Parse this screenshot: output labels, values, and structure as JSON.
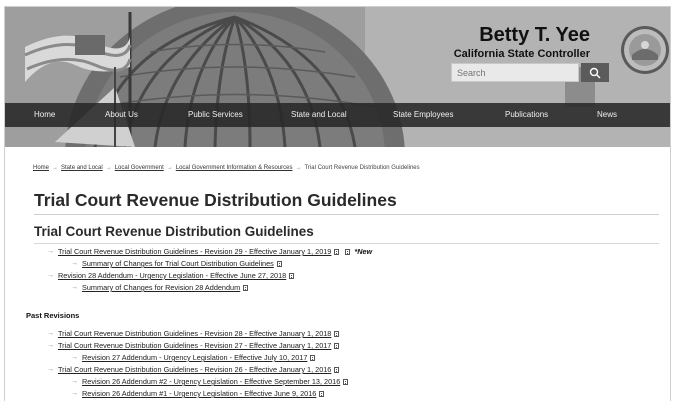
{
  "header": {
    "name": "Betty T. Yee",
    "office": "California State Controller",
    "search_placeholder": "Search"
  },
  "nav": [
    "Home",
    "About Us",
    "Public Services",
    "State and Local",
    "State Employees",
    "Publications",
    "News"
  ],
  "breadcrumb": [
    "Home",
    "State and Local",
    "Local Government",
    "Local Government Information & Resources",
    "Trial Court Revenue Distribution Guidelines"
  ],
  "page_title": "Trial Court Revenue Distribution Guidelines",
  "section_title": "Trial Court Revenue Distribution Guidelines",
  "current_links": [
    "Trial Court Revenue Distribution Guidelines - Revision 29 - Effective January 1, 2019",
    "Summary of Changes for Trial Court Distribution Guidelines",
    "Revision 28 Addendum - Urgency Legislation - Effective June 27, 2018",
    "Summary of Changes for Revision 28 Addendum"
  ],
  "new_label": "*New",
  "past_heading": "Past Revisions",
  "past_links": [
    "Trial Court Revenue Distribution Guidelines - Revision 28 - Effective January 1, 2018",
    "Trial Court Revenue Distribution Guidelines - Revision 27 - Effective January 1, 2017",
    "Revision 27 Addendum - Urgency Legislation - Effective July 10, 2017",
    "Trial Court Revenue Distribution Guidelines - Revision 26 - Effective January 1, 2016",
    "Revision 26 Addendum #2 - Urgency Legislation - Effective September 13, 2016",
    "Revision 26 Addendum #1 - Urgency Legislation - Effective June 9, 2016"
  ]
}
